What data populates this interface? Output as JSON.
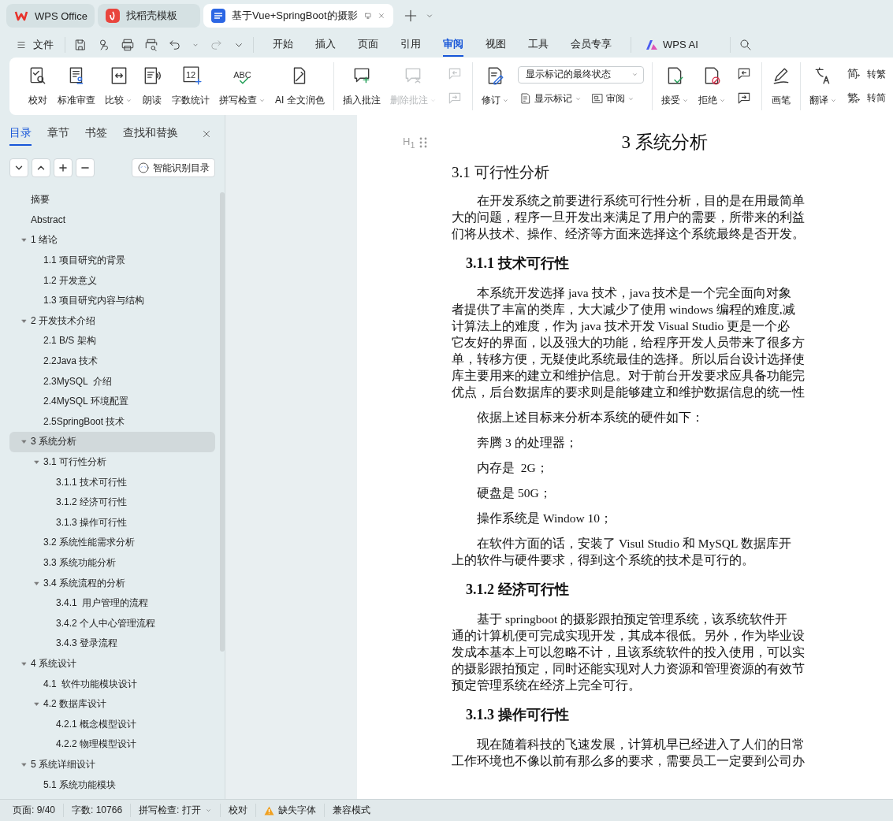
{
  "browser_tabs": [
    {
      "title": "WPS Office",
      "selected": false
    },
    {
      "title": "找稻壳模板",
      "selected": false
    },
    {
      "title": "基于Vue+SpringBoot的摄影",
      "selected": true
    }
  ],
  "menu": {
    "file": "文件",
    "tabs": [
      {
        "label": "开始",
        "selected": false
      },
      {
        "label": "插入",
        "selected": false
      },
      {
        "label": "页面",
        "selected": false
      },
      {
        "label": "引用",
        "selected": false
      },
      {
        "label": "审阅",
        "selected": true
      },
      {
        "label": "视图",
        "selected": false
      },
      {
        "label": "工具",
        "selected": false
      },
      {
        "label": "会员专享",
        "selected": false
      }
    ],
    "ai": "WPS AI"
  },
  "ribbon": {
    "groups": [
      [
        {
          "kind": "large",
          "label": "校对",
          "dropdown": false,
          "disabled": false
        },
        {
          "kind": "large",
          "label": "标准审查",
          "dropdown": false,
          "disabled": false
        },
        {
          "kind": "large",
          "label": "比较",
          "dropdown": true,
          "disabled": false
        },
        {
          "kind": "large",
          "label": "朗读",
          "dropdown": false,
          "disabled": false
        },
        {
          "kind": "large",
          "label": "字数统计",
          "icon_text": "12",
          "dropdown": false,
          "disabled": false
        },
        {
          "kind": "large",
          "label": "拼写检查",
          "icon_text": "ABC",
          "dropdown": true,
          "disabled": false
        },
        {
          "kind": "large",
          "label": "AI 全文润色",
          "dropdown": false,
          "disabled": false
        }
      ],
      [
        {
          "kind": "large",
          "label": "插入批注",
          "dropdown": false,
          "disabled": false
        },
        {
          "kind": "large",
          "label": "删除批注",
          "dropdown": true,
          "disabled": true
        },
        {
          "kind": "stack",
          "rows": [
            [
              {
                "kind": "icon",
                "disabled": true
              }
            ],
            [
              {
                "kind": "icon",
                "disabled": true
              }
            ]
          ]
        }
      ],
      [
        {
          "kind": "large",
          "label": "修订",
          "dropdown": true,
          "disabled": false
        },
        {
          "kind": "stack",
          "rows": [
            [
              {
                "kind": "select",
                "value": "显示标记的最终状态"
              }
            ],
            [
              {
                "kind": "small",
                "label": "显示标记",
                "dropdown": true,
                "disabled": false
              },
              {
                "kind": "small",
                "label": "审阅",
                "dropdown": true,
                "disabled": false
              }
            ]
          ]
        }
      ],
      [
        {
          "kind": "large",
          "label": "接受",
          "dropdown": true,
          "disabled": false
        },
        {
          "kind": "large",
          "label": "拒绝",
          "dropdown": true,
          "disabled": false
        },
        {
          "kind": "stack",
          "rows": [
            [
              {
                "kind": "icon",
                "disabled": false
              }
            ],
            [
              {
                "kind": "icon",
                "disabled": false
              }
            ]
          ]
        }
      ],
      [
        {
          "kind": "large",
          "label": "画笔",
          "dropdown": false,
          "disabled": false
        }
      ],
      [
        {
          "kind": "large",
          "label": "翻译",
          "dropdown": true,
          "disabled": false
        },
        {
          "kind": "stack",
          "rows": [
            [
              {
                "kind": "small",
                "label": "转繁",
                "icon_text": "简",
                "dropdown": false,
                "disabled": false
              }
            ],
            [
              {
                "kind": "small",
                "label": "转简",
                "icon_text": "繁",
                "dropdown": false,
                "disabled": false
              }
            ]
          ]
        }
      ]
    ]
  },
  "sidebar": {
    "tabs": [
      {
        "label": "目录",
        "selected": true
      },
      {
        "label": "章节",
        "selected": false
      },
      {
        "label": "书签",
        "selected": false
      },
      {
        "label": "查找和替换",
        "selected": false
      }
    ],
    "smart_button": "智能识别目录",
    "toc": [
      {
        "label": "摘要",
        "selected": false
      },
      {
        "label": "Abstract",
        "selected": false
      },
      {
        "label": "1 绪论",
        "selected": false,
        "expanded": true,
        "children": [
          {
            "label": "1.1 项目研究的背景",
            "selected": false
          },
          {
            "label": "1.2 开发意义",
            "selected": false
          },
          {
            "label": "1.3 项目研究内容与结构",
            "selected": false
          }
        ]
      },
      {
        "label": "2 开发技术介绍",
        "selected": false,
        "expanded": true,
        "children": [
          {
            "label": "2.1 B/S 架构",
            "selected": false
          },
          {
            "label": "2.2Java 技术",
            "selected": false
          },
          {
            "label": "2.3MySQL  介绍",
            "selected": false
          },
          {
            "label": "2.4MySQL 环境配置",
            "selected": false
          },
          {
            "label": "2.5SpringBoot 技术",
            "selected": false
          }
        ]
      },
      {
        "label": "3 系统分析",
        "selected": true,
        "expanded": true,
        "children": [
          {
            "label": "3.1 可行性分析",
            "selected": false,
            "expanded": true,
            "children": [
              {
                "label": "3.1.1 技术可行性",
                "selected": false
              },
              {
                "label": "3.1.2 经济可行性",
                "selected": false
              },
              {
                "label": "3.1.3 操作可行性",
                "selected": false
              }
            ]
          },
          {
            "label": "3.2 系统性能需求分析",
            "selected": false
          },
          {
            "label": "3.3 系统功能分析",
            "selected": false
          },
          {
            "label": "3.4 系统流程的分析",
            "selected": false,
            "expanded": true,
            "children": [
              {
                "label": "3.4.1  用户管理的流程",
                "selected": false
              },
              {
                "label": "3.4.2 个人中心管理流程",
                "selected": false
              },
              {
                "label": "3.4.3 登录流程",
                "selected": false
              }
            ]
          }
        ]
      },
      {
        "label": "4 系统设计",
        "selected": false,
        "expanded": true,
        "children": [
          {
            "label": "4.1  软件功能模块设计",
            "selected": false
          },
          {
            "label": "4.2 数据库设计",
            "selected": false,
            "expanded": true,
            "children": [
              {
                "label": "4.2.1 概念模型设计",
                "selected": false
              },
              {
                "label": "4.2.2 物理模型设计",
                "selected": false
              }
            ]
          }
        ]
      },
      {
        "label": "5 系统详细设计",
        "selected": false,
        "expanded": true,
        "children": [
          {
            "label": "5.1 系统功能模块",
            "selected": false
          }
        ]
      }
    ]
  },
  "document": {
    "heading_marker": "H$_{1}$",
    "blocks": [
      {
        "kind": "h1",
        "text": "3 系统分析"
      },
      {
        "kind": "h2",
        "text": "3.1 可行性分析"
      },
      {
        "kind": "para",
        "lines": [
          "在开发系统之前要进行系统可行性分析，目的是在用最简单",
          "大的问题，程序一旦开发出来满足了用户的需要，所带来的利益",
          "们将从技术、操作、经济等方面来选择这个系统最终是否开发。"
        ]
      },
      {
        "kind": "h3",
        "text": "3.1.1 技术可行性"
      },
      {
        "kind": "para",
        "lines": [
          "本系统开发选择 java 技术，java 技术是一个完全面向对象",
          "者提供了丰富的类库，大大减少了使用 windows 编程的难度,减",
          "计算法上的难度，作为 java 技术开发 Visual Studio 更是一个必",
          "它友好的界面，以及强大的功能，给程序开发人员带来了很多方",
          "单，转移方便，无疑使此系统最佳的选择。所以后台设计选择使",
          "库主要用来的建立和维护信息。对于前台开发要求应具备功能完",
          "优点，后台数据库的要求则是能够建立和维护数据信息的统一性"
        ]
      },
      {
        "kind": "para",
        "lines": [
          "依据上述目标来分析本系统的硬件如下："
        ]
      },
      {
        "kind": "para",
        "lines": [
          "奔腾 3 的处理器；"
        ]
      },
      {
        "kind": "para",
        "lines": [
          "内存是  2G；"
        ]
      },
      {
        "kind": "para",
        "lines": [
          "硬盘是 50G；"
        ]
      },
      {
        "kind": "para",
        "lines": [
          "操作系统是 Window 10；"
        ]
      },
      {
        "kind": "para",
        "lines": [
          "在软件方面的话，安装了 Visul Studio 和 MySQL 数据库开",
          "上的软件与硬件要求，得到这个系统的技术是可行的。"
        ]
      },
      {
        "kind": "h3",
        "text": "3.1.2 经济可行性"
      },
      {
        "kind": "para",
        "lines": [
          "基于 springboot 的摄影跟拍预定管理系统，该系统软件开",
          "通的计算机便可完成实现开发，其成本很低。另外，作为毕业设",
          "发成本基本上可以忽略不计，且该系统软件的投入使用，可以实",
          "的摄影跟拍预定，同时还能实现对人力资源和管理资源的有效节",
          "预定管理系统在经济上完全可行。"
        ]
      },
      {
        "kind": "h3",
        "text": "3.1.3 操作可行性"
      },
      {
        "kind": "para",
        "lines": [
          "现在随着科技的飞速发展，计算机早已经进入了人们的日常",
          "工作环境也不像以前有那么多的要求，需要员工一定要到公司办"
        ]
      }
    ]
  },
  "status_bar": [
    {
      "kind": "text",
      "label": "页面: 9/40"
    },
    {
      "kind": "text",
      "label": "字数: 10766"
    },
    {
      "kind": "dropdown",
      "label": "拼写检查: 打开"
    },
    {
      "kind": "text",
      "label": "校对"
    },
    {
      "kind": "warning",
      "label": "缺失字体"
    },
    {
      "kind": "text",
      "label": "兼容模式"
    }
  ]
}
